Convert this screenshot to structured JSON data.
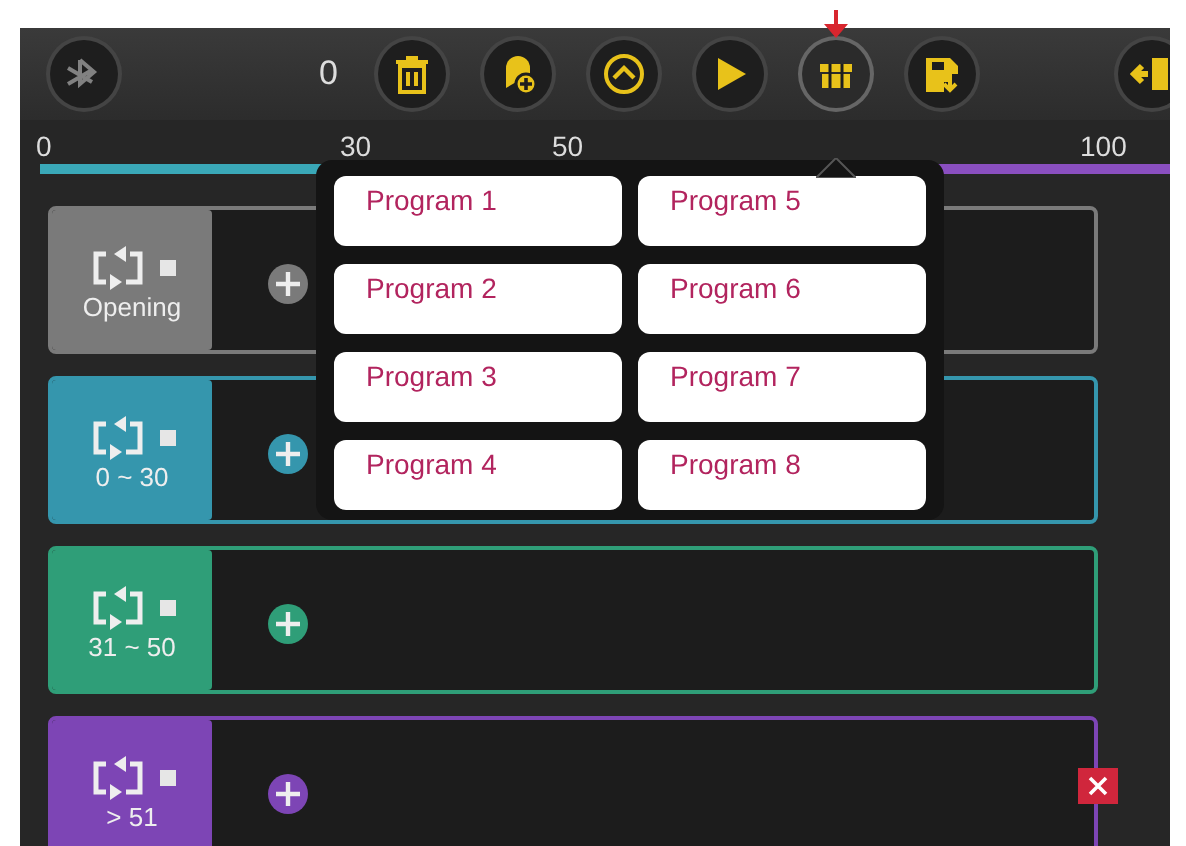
{
  "toolbar": {
    "counter": "0",
    "buttons": [
      {
        "kind": "bluetooth",
        "enabled": false,
        "selected": false
      },
      {
        "kind": "trash",
        "enabled": true,
        "selected": false
      },
      {
        "kind": "add-block",
        "enabled": true,
        "selected": false
      },
      {
        "kind": "up",
        "enabled": true,
        "selected": false
      },
      {
        "kind": "play",
        "enabled": true,
        "selected": false
      },
      {
        "kind": "programs",
        "enabled": true,
        "selected": true
      },
      {
        "kind": "save",
        "enabled": true,
        "selected": false
      },
      {
        "kind": "exit",
        "enabled": true,
        "selected": false
      }
    ]
  },
  "scale": {
    "labels": [
      "0",
      "30",
      "50",
      "100"
    ],
    "segments": [
      {
        "color": "#3aa8b8"
      },
      {
        "color": "#8a4fc0"
      }
    ]
  },
  "rows": [
    {
      "label": "Opening",
      "color": "#7a7a7a",
      "deletable": false
    },
    {
      "label": "0 ~ 30",
      "color": "#3596ad",
      "deletable": false
    },
    {
      "label": "31 ~ 50",
      "color": "#2f9e78",
      "deletable": false
    },
    {
      "label": "> 51",
      "color": "#7d45b5",
      "deletable": true
    }
  ],
  "programs_menu": {
    "items": [
      {
        "label": "Program 1"
      },
      {
        "label": "Program 2"
      },
      {
        "label": "Program 3"
      },
      {
        "label": "Program 4"
      },
      {
        "label": "Program 5"
      },
      {
        "label": "Program 6"
      },
      {
        "label": "Program 7"
      },
      {
        "label": "Program 8"
      }
    ]
  }
}
